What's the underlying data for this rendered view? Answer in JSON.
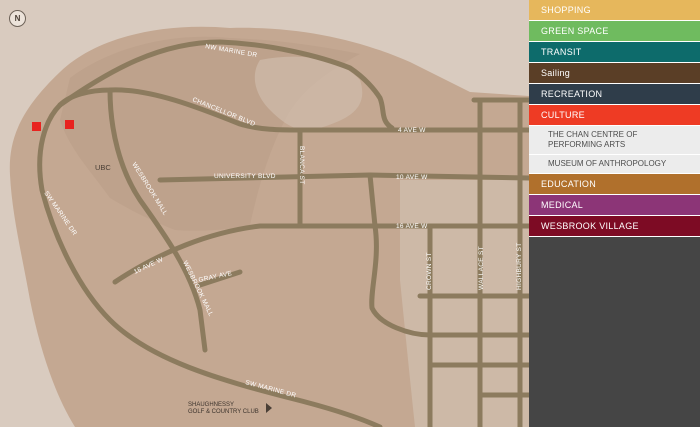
{
  "compass": {
    "label": "N"
  },
  "map": {
    "colors": {
      "water": "#d9cbbf",
      "land": "#c4a892",
      "campus": "#b89b86",
      "road": "#8c7b5e",
      "marker": "#e8231f"
    },
    "roads": {
      "nw_marine": "NW MARINE DR",
      "chancellor": "CHANCELLOR BLVD",
      "ave4": "4 AVE W",
      "university": "UNIVERSITY BLVD",
      "ave10": "10 AVE W",
      "ave16a": "16 AVE W",
      "ave16b": "16 AVE W",
      "sw_marine_a": "SW MARINE DR",
      "sw_marine_b": "SW MARINE DR",
      "blanca": "BLANCA ST",
      "wesbrook_a": "WESBROOK MALL",
      "wesbrook_b": "WESBROOK MALL",
      "gray": "GRAY AVE",
      "crown": "CROWN ST",
      "wallace": "WALLACE ST",
      "highbury": "HIGHBURY ST"
    },
    "areas": {
      "ubc": "UBC"
    },
    "golf": {
      "line1": "SHAUGHNESSY",
      "line2": "GOLF & COUNTRY CLUB"
    },
    "markers": [
      "chan-centre",
      "museum-of-anthropology"
    ]
  },
  "categories": [
    {
      "label": "SHOPPING",
      "color": "#e6b75c"
    },
    {
      "label": "GREEN SPACE",
      "color": "#6fbb5f"
    },
    {
      "label": "TRANSIT",
      "color": "#0d6b6b"
    },
    {
      "label": "Sailing",
      "color": "#5a3e26"
    },
    {
      "label": "RECREATION",
      "color": "#2f3d4a"
    },
    {
      "label": "CULTURE",
      "color": "#ee3b24"
    },
    {
      "label": "EDUCATION",
      "color": "#b0702c"
    },
    {
      "label": "MEDICAL",
      "color": "#8c3577"
    },
    {
      "label": "WESBROOK VILLAGE",
      "color": "#7d0b24"
    }
  ],
  "culture_items": [
    "THE CHAN CENTRE OF PERFORMING ARTS",
    "MUSEUM OF ANTHROPOLOGY"
  ]
}
